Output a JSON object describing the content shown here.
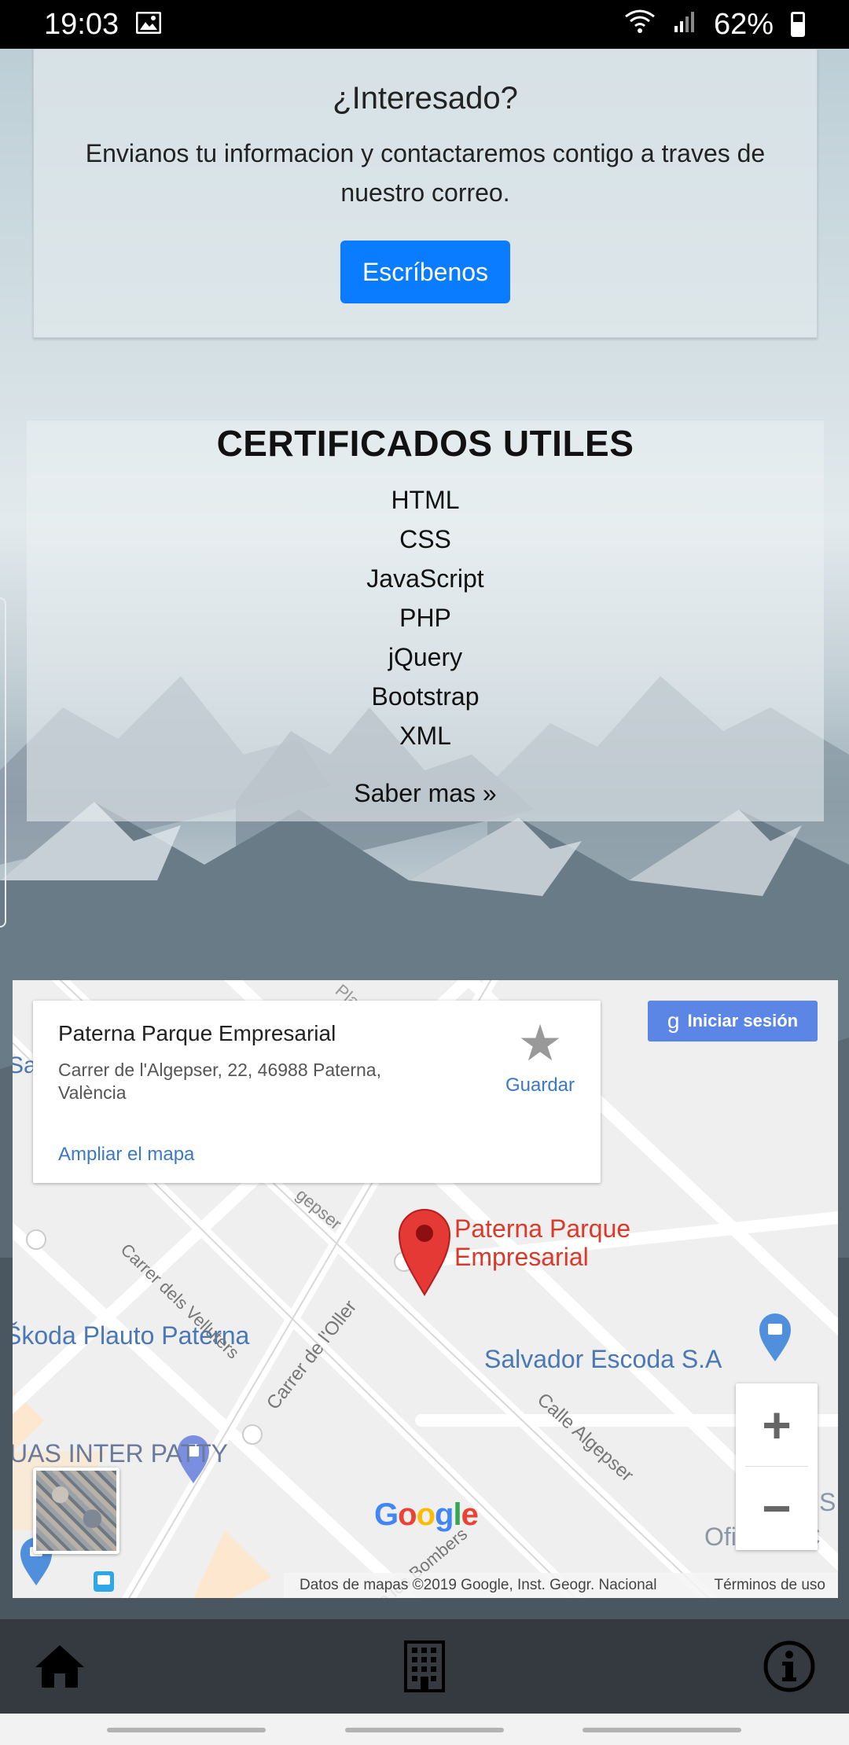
{
  "status_bar": {
    "time": "19:03",
    "image_icon": "image-icon",
    "wifi_icon": "wifi-icon",
    "signal_icon": "signal-icon",
    "battery": "62%"
  },
  "interested": {
    "title": "¿Interesado?",
    "text": "Envianos tu informacion y contactaremos contigo a traves de nuestro correo.",
    "button": "Escríbenos",
    "button_color": "#0a7cff"
  },
  "certificates": {
    "title": "CERTIFICADOS UTILES",
    "items": [
      "HTML",
      "CSS",
      "JavaScript",
      "PHP",
      "jQuery",
      "Bootstrap",
      "XML"
    ],
    "more": "Saber mas »"
  },
  "map": {
    "place_title": "Paterna Parque Empresarial",
    "address": "Carrer de l'Algepser, 22, 46988 Paterna, València",
    "enlarge": "Ampliar el mapa",
    "save": "Guardar",
    "sign_in": "Iniciar sesión",
    "pin_label": "Paterna Parque Empresarial",
    "labels": {
      "skoda": "Škoda Plauto Paterna",
      "salvador": "Salvador Escoda S.A",
      "inter_patty": "UAS INTER PATTY",
      "velluters": "Carrer dels Velluters",
      "oller": "Carrer de l'Oller",
      "algepser": "Calle Algepser",
      "algepser_top": "gepser",
      "bombers": "de los Bombers",
      "pl": "Pla",
      "left_sa": "Sa",
      "oficinas": "Oficinas C",
      "right_s": "S"
    },
    "zoom_in": "+",
    "zoom_out": "−",
    "attribution": "Datos de mapas ©2019 Google, Inst. Geogr. Nacional",
    "terms": "Términos de uso",
    "google": [
      "G",
      "o",
      "o",
      "g",
      "l",
      "e"
    ]
  },
  "nav": {
    "home_icon": "home-icon",
    "building_icon": "building-icon",
    "info_icon": "info-icon"
  }
}
